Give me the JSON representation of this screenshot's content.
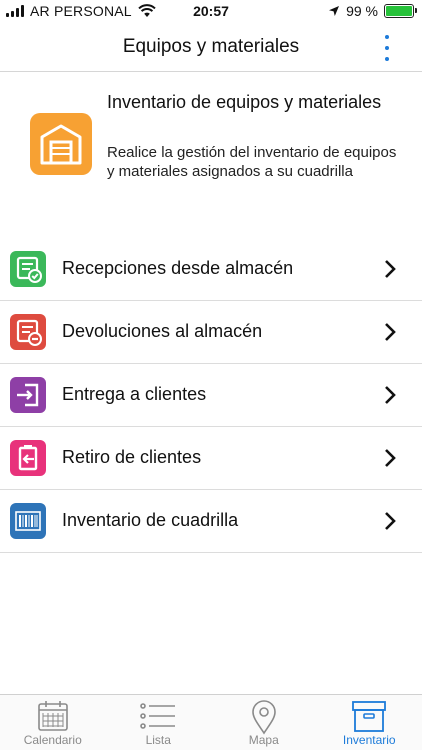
{
  "status_bar": {
    "carrier": "AR PERSONAL",
    "time": "20:57",
    "battery": "99 %",
    "battery_level": 0.99
  },
  "header": {
    "title": "Equipos y materiales"
  },
  "intro": {
    "title": "Inventario de equipos y materiales",
    "description": "Realice la gestión del inventario de equipos y materiales asignados a su cuadrilla",
    "icon": "warehouse-icon",
    "icon_color": "#f7a133"
  },
  "menu": {
    "items": [
      {
        "label": "Recepciones desde almacén",
        "icon": "reception-icon",
        "color": "#3bb85a"
      },
      {
        "label": "Devoluciones al almacén",
        "icon": "return-icon",
        "color": "#de4b3f"
      },
      {
        "label": "Entrega a clientes",
        "icon": "delivery-icon",
        "color": "#8e3fa6"
      },
      {
        "label": "Retiro de clientes",
        "icon": "pickup-icon",
        "color": "#e8327b"
      },
      {
        "label": "Inventario de cuadrilla",
        "icon": "barcode-icon",
        "color": "#2e74b8"
      }
    ]
  },
  "tab_bar": {
    "tabs": [
      {
        "label": "Calendario",
        "icon": "calendar-icon"
      },
      {
        "label": "Lista",
        "icon": "list-icon"
      },
      {
        "label": "Mapa",
        "icon": "map-pin-icon"
      },
      {
        "label": "Inventario",
        "icon": "inventory-box-icon",
        "active": true
      }
    ],
    "active_color": "#1d7bd9"
  }
}
